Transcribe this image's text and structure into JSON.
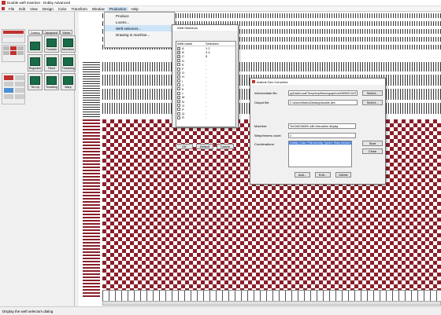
{
  "window": {
    "title": "Double weft insertion - Dobby Advanced"
  },
  "menubar": [
    "File",
    "Edit",
    "View",
    "Design",
    "Color",
    "Transform",
    "Window",
    "Production",
    "Help"
  ],
  "dropdown": {
    "items": [
      "Produce",
      "Looms...",
      "Weft selectors...",
      "Drawing in machine..."
    ]
  },
  "toolbox": {
    "tabs": [
      "Dobby",
      "Jacquard",
      "Yarns"
    ],
    "tools": [
      "",
      "Function",
      "Machines",
      "Regulator",
      "Reed",
      "Threading",
      "Tie-Up",
      "Treadling",
      "Warp"
    ]
  },
  "weft_dialog": {
    "title": "Weft Selectors",
    "columns": [
      "Weft name",
      "Selectors"
    ],
    "rows": [
      {
        "name": "A",
        "sel": "1 2",
        "checked": true
      },
      {
        "name": "B",
        "sel": "3 4",
        "checked": true
      },
      {
        "name": "C",
        "sel": "5",
        "checked": true
      },
      {
        "name": "D",
        "sel": "-",
        "checked": false
      },
      {
        "name": "E",
        "sel": "-",
        "checked": false
      },
      {
        "name": "F",
        "sel": "-",
        "checked": false
      },
      {
        "name": "G",
        "sel": "-",
        "checked": false
      },
      {
        "name": "H",
        "sel": "-",
        "checked": false
      },
      {
        "name": "I",
        "sel": "-",
        "checked": false
      },
      {
        "name": "J",
        "sel": "-",
        "checked": false
      },
      {
        "name": "K",
        "sel": "-",
        "checked": false
      },
      {
        "name": "L",
        "sel": "-",
        "checked": false
      },
      {
        "name": "M",
        "sel": "-",
        "checked": false
      },
      {
        "name": "N",
        "sel": "-",
        "checked": false
      },
      {
        "name": "O",
        "sel": "-",
        "checked": false
      },
      {
        "name": "P",
        "sel": "-",
        "checked": false
      },
      {
        "name": "Q",
        "sel": "-",
        "checked": false
      },
      {
        "name": "R",
        "sel": "-",
        "checked": false
      }
    ],
    "ok": "OK",
    "default": "Default",
    "cancel": "Cancel"
  },
  "converter": {
    "title": "Arahne Dex Convertor",
    "intermediate_label": "Intermediate file:",
    "intermediate_value": "ppData\\Local\\Temp\\tmpWeavegraphics0089500.DAT",
    "output_label": "Output file:",
    "output_value": "C:\\Users\\Marko\\Desktop\\double.dex",
    "machine_label": "Machine:",
    "machine_value": "TexCtrlDX6000 with Interactive display",
    "warp_label": "Warp/beams count:",
    "warp_value": "1",
    "combinations_label": "Combinations:",
    "combination_selected": "Dobby, Color, Pick density, Speed, Warp tension",
    "select1": "Select...",
    "select2": "Select...",
    "start": "Start",
    "close": "Close",
    "add": "Add...",
    "edit": "Edit...",
    "delete": "Delete"
  },
  "status": "Display the weft selectors dialog",
  "colors": {
    "fabric": "#8a1f2a",
    "highlight": "#cde4f7",
    "selection": "#3b78d4"
  }
}
